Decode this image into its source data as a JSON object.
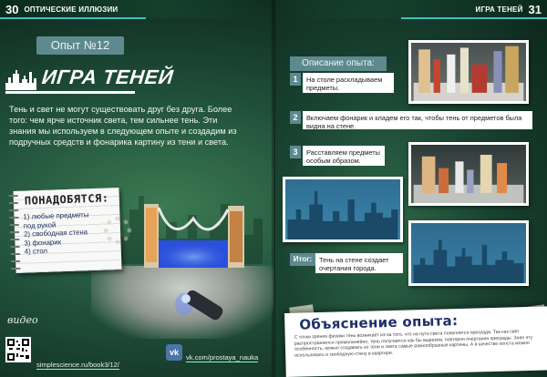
{
  "header": {
    "left_page_number": "30",
    "left_section": "Оптические иллюзии",
    "right_section": "Игра теней",
    "right_page_number": "31"
  },
  "experiment": {
    "number_label": "Опыт №12",
    "title": "ИГРА ТЕНЕЙ",
    "intro": "Тень и свет не могут существовать друг без друга. Более того: чем ярче источник света, тем сильнее тень. Эти знания мы используем в следующем опыте и создадим из подручных средств и фонарика картину из тени и света."
  },
  "needed": {
    "title": "ПОНАДОБЯТСЯ:",
    "items": [
      "1) любые предметы",
      "под рукой",
      "2) свободная стена",
      "3) фонарик",
      "4) стол"
    ]
  },
  "video": {
    "label": "видео",
    "link": "simplescience.ru/book3/12/",
    "vk_icon_text": "vk",
    "vk_link": "vk.com/prostaya_nauka"
  },
  "description": {
    "title": "Описание опыта:",
    "steps": [
      {
        "num": "1",
        "text": "На столе раскладываем предметы."
      },
      {
        "num": "2",
        "text": "Включаем фонарик и кладем его так, чтобы тень от предметов была видна на стене."
      },
      {
        "num": "3",
        "text": "Расставляем предметы особым образом."
      }
    ],
    "result_label": "Итог:",
    "result_text": "Тень на стене создает очертания города."
  },
  "explanation": {
    "title": "Объяснение опыта:",
    "text": "С точки зрения физики тень возникает из-за того, что на пути света появляется преграда. Так как свет распространяется прямолинейно, тень получается как бы вырезом, повторяя очертания преграды. Зная эту особенность, можно создавать из тени и света самые разнообразные картины. А в качестве холста можно использовать и свободную стену в квартире."
  },
  "colors": {
    "label_bg": "#5e8a8f",
    "accent": "#3fbfbf",
    "explanation_title": "#1f2f6a"
  },
  "icons": [
    "city-skyline-icon",
    "qr-code-icon",
    "vk-logo-icon",
    "gear-icon",
    "flashlight-icon"
  ]
}
